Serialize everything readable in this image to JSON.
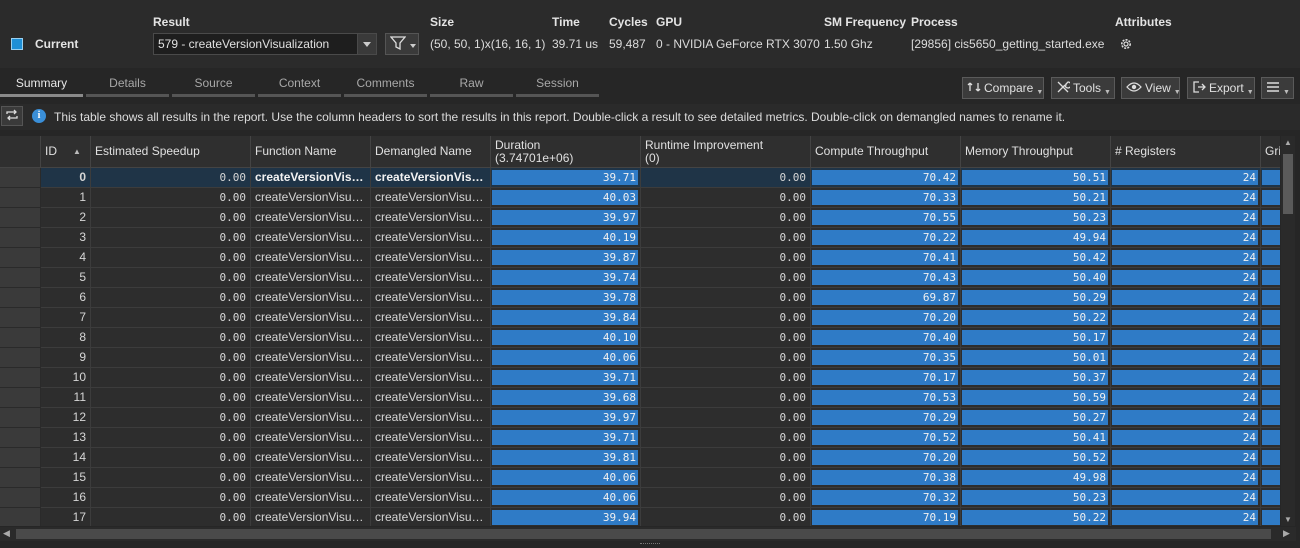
{
  "header": {
    "current_label": "Current",
    "result_header": "Result",
    "result_value": "579 - createVersionVisualization",
    "size_header": "Size",
    "size_value": "(50, 50, 1)x(16, 16, 1)",
    "time_header": "Time",
    "time_value": "39.71 us",
    "cycles_header": "Cycles",
    "cycles_value": "59,487",
    "gpu_header": "GPU",
    "gpu_value": "0 - NVIDIA GeForce RTX 3070",
    "smfreq_header": "SM Frequency",
    "smfreq_value": "1.50 Ghz",
    "process_header": "Process",
    "process_value": "[29856] cis5650_getting_started.exe",
    "attributes_header": "Attributes",
    "current_color": "#1e8fd6"
  },
  "tabs": [
    "Summary",
    "Details",
    "Source",
    "Context",
    "Comments",
    "Raw",
    "Session"
  ],
  "toolbar": {
    "compare_label": "Compare",
    "tools_label": "Tools",
    "view_label": "View",
    "export_label": "Export"
  },
  "info_text": "This table shows all results in the report. Use the column headers to sort the results in this report. Double-click a result to see detailed metrics. Double-click on demangled names to rename it.",
  "columns": {
    "id": "ID",
    "speedup": "Estimated Speedup",
    "function": "Function Name",
    "demangled": "Demangled Name",
    "duration": "Duration",
    "duration_sub": "(3.74701e+06)",
    "runtime": "Runtime Improvement",
    "runtime_sub": "(0)",
    "compute": "Compute Throughput",
    "memory": "Memory Throughput",
    "registers": "# Registers",
    "grid": "Gri"
  },
  "rows": [
    {
      "id": "0",
      "speedup": "0.00",
      "function": "createVersionVisualization",
      "demangled": "createVersionVisualization",
      "duration": "39.71",
      "runtime": "0.00",
      "compute": "70.42",
      "memory": "50.51",
      "registers": "24"
    },
    {
      "id": "1",
      "speedup": "0.00",
      "function": "createVersionVisualization",
      "demangled": "createVersionVisualization",
      "duration": "40.03",
      "runtime": "0.00",
      "compute": "70.33",
      "memory": "50.21",
      "registers": "24"
    },
    {
      "id": "2",
      "speedup": "0.00",
      "function": "createVersionVisualization",
      "demangled": "createVersionVisualization",
      "duration": "39.97",
      "runtime": "0.00",
      "compute": "70.55",
      "memory": "50.23",
      "registers": "24"
    },
    {
      "id": "3",
      "speedup": "0.00",
      "function": "createVersionVisualization",
      "demangled": "createVersionVisualization",
      "duration": "40.19",
      "runtime": "0.00",
      "compute": "70.22",
      "memory": "49.94",
      "registers": "24"
    },
    {
      "id": "4",
      "speedup": "0.00",
      "function": "createVersionVisualization",
      "demangled": "createVersionVisualization",
      "duration": "39.87",
      "runtime": "0.00",
      "compute": "70.41",
      "memory": "50.42",
      "registers": "24"
    },
    {
      "id": "5",
      "speedup": "0.00",
      "function": "createVersionVisualization",
      "demangled": "createVersionVisualization",
      "duration": "39.74",
      "runtime": "0.00",
      "compute": "70.43",
      "memory": "50.40",
      "registers": "24"
    },
    {
      "id": "6",
      "speedup": "0.00",
      "function": "createVersionVisualization",
      "demangled": "createVersionVisualization",
      "duration": "39.78",
      "runtime": "0.00",
      "compute": "69.87",
      "memory": "50.29",
      "registers": "24"
    },
    {
      "id": "7",
      "speedup": "0.00",
      "function": "createVersionVisualization",
      "demangled": "createVersionVisualization",
      "duration": "39.84",
      "runtime": "0.00",
      "compute": "70.20",
      "memory": "50.22",
      "registers": "24"
    },
    {
      "id": "8",
      "speedup": "0.00",
      "function": "createVersionVisualization",
      "demangled": "createVersionVisualization",
      "duration": "40.10",
      "runtime": "0.00",
      "compute": "70.40",
      "memory": "50.17",
      "registers": "24"
    },
    {
      "id": "9",
      "speedup": "0.00",
      "function": "createVersionVisualization",
      "demangled": "createVersionVisualization",
      "duration": "40.06",
      "runtime": "0.00",
      "compute": "70.35",
      "memory": "50.01",
      "registers": "24"
    },
    {
      "id": "10",
      "speedup": "0.00",
      "function": "createVersionVisualization",
      "demangled": "createVersionVisualization",
      "duration": "39.71",
      "runtime": "0.00",
      "compute": "70.17",
      "memory": "50.37",
      "registers": "24"
    },
    {
      "id": "11",
      "speedup": "0.00",
      "function": "createVersionVisualization",
      "demangled": "createVersionVisualization",
      "duration": "39.68",
      "runtime": "0.00",
      "compute": "70.53",
      "memory": "50.59",
      "registers": "24"
    },
    {
      "id": "12",
      "speedup": "0.00",
      "function": "createVersionVisualization",
      "demangled": "createVersionVisualization",
      "duration": "39.97",
      "runtime": "0.00",
      "compute": "70.29",
      "memory": "50.27",
      "registers": "24"
    },
    {
      "id": "13",
      "speedup": "0.00",
      "function": "createVersionVisualization",
      "demangled": "createVersionVisualization",
      "duration": "39.71",
      "runtime": "0.00",
      "compute": "70.52",
      "memory": "50.41",
      "registers": "24"
    },
    {
      "id": "14",
      "speedup": "0.00",
      "function": "createVersionVisualization",
      "demangled": "createVersionVisualization",
      "duration": "39.81",
      "runtime": "0.00",
      "compute": "70.20",
      "memory": "50.52",
      "registers": "24"
    },
    {
      "id": "15",
      "speedup": "0.00",
      "function": "createVersionVisualization",
      "demangled": "createVersionVisualization",
      "duration": "40.06",
      "runtime": "0.00",
      "compute": "70.38",
      "memory": "49.98",
      "registers": "24"
    },
    {
      "id": "16",
      "speedup": "0.00",
      "function": "createVersionVisualization",
      "demangled": "createVersionVisualization",
      "duration": "40.06",
      "runtime": "0.00",
      "compute": "70.32",
      "memory": "50.23",
      "registers": "24"
    },
    {
      "id": "17",
      "speedup": "0.00",
      "function": "createVersionVisualization",
      "demangled": "createVersionVisualization",
      "duration": "39.94",
      "runtime": "0.00",
      "compute": "70.19",
      "memory": "50.22",
      "registers": "24"
    }
  ],
  "colors": {
    "bar_fill": "#2f7bc6",
    "selected_row": "#1f3447",
    "accent": "#3a8fd8"
  }
}
